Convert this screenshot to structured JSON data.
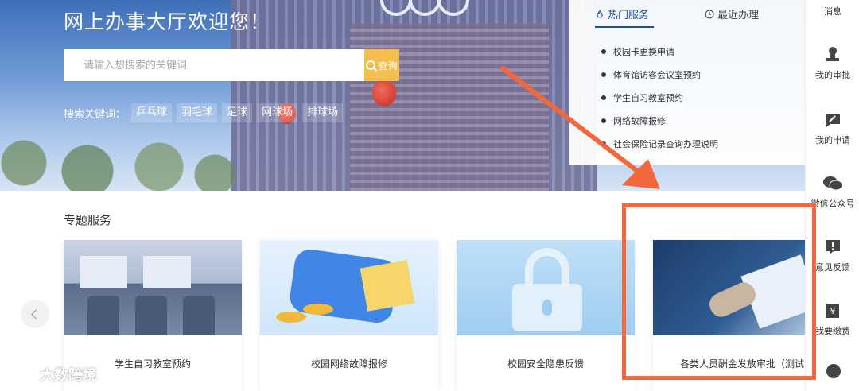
{
  "hero": {
    "title": "网上办事大厅欢迎您！",
    "search_placeholder": "请输入想搜索的关键词",
    "search_button": "查询",
    "keywords_label": "搜索关键词：",
    "keywords": [
      "乒乓球",
      "羽毛球",
      "足球",
      "网球场",
      "排球场"
    ]
  },
  "panel": {
    "tabs": [
      {
        "label": "热门服务",
        "icon": "fire-icon"
      },
      {
        "label": "最近办理",
        "icon": "clock-icon"
      }
    ],
    "items": [
      "校园卡更换申请",
      "体育馆访客会议室预约",
      "学生自习教室预约",
      "网络故障报修",
      "社会保险记录查询办理说明"
    ]
  },
  "sidebar": {
    "items": [
      {
        "label": "消息",
        "icon": "message-icon"
      },
      {
        "label": "我的审批",
        "icon": "approval-stamp-icon"
      },
      {
        "label": "我的申请",
        "icon": "edit-application-icon"
      },
      {
        "label": "微信公众号",
        "icon": "wechat-icon"
      },
      {
        "label": "意见反馈",
        "icon": "feedback-icon"
      },
      {
        "label": "我要缴费",
        "icon": "payment-icon"
      }
    ]
  },
  "section": {
    "title": "专题服务",
    "cards": [
      {
        "label": "学生自习教室预约"
      },
      {
        "label": "校园网络故障报修"
      },
      {
        "label": "校园安全隐患反馈"
      },
      {
        "label": "各类人员酬金发放审批（测试"
      }
    ]
  },
  "watermark": {
    "text": "大数跨境"
  },
  "colors": {
    "accent": "#1f4f91",
    "search_button": "#f4bf4f",
    "annotation": "#f2673b"
  }
}
